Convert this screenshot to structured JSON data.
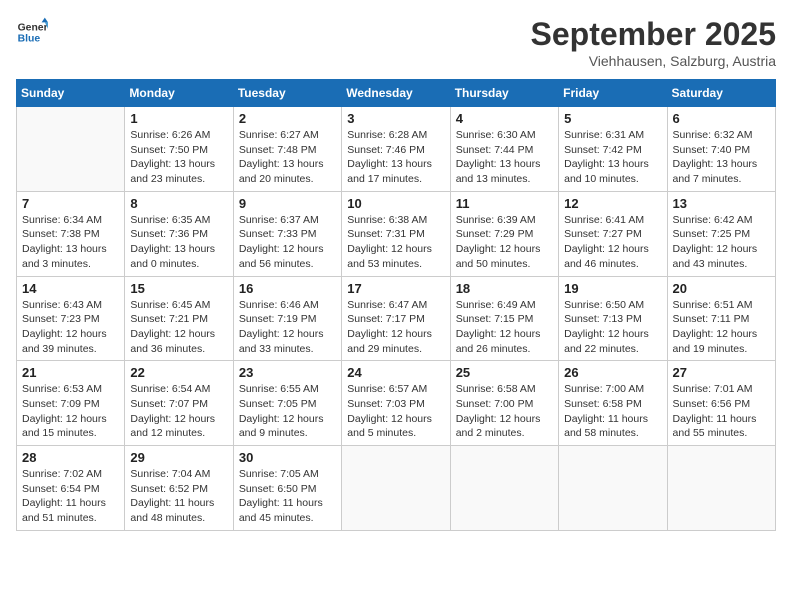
{
  "header": {
    "logo_line1": "General",
    "logo_line2": "Blue",
    "month_title": "September 2025",
    "location": "Viehhausen, Salzburg, Austria"
  },
  "weekdays": [
    "Sunday",
    "Monday",
    "Tuesday",
    "Wednesday",
    "Thursday",
    "Friday",
    "Saturday"
  ],
  "weeks": [
    [
      {
        "day": "",
        "info": ""
      },
      {
        "day": "1",
        "info": "Sunrise: 6:26 AM\nSunset: 7:50 PM\nDaylight: 13 hours\nand 23 minutes."
      },
      {
        "day": "2",
        "info": "Sunrise: 6:27 AM\nSunset: 7:48 PM\nDaylight: 13 hours\nand 20 minutes."
      },
      {
        "day": "3",
        "info": "Sunrise: 6:28 AM\nSunset: 7:46 PM\nDaylight: 13 hours\nand 17 minutes."
      },
      {
        "day": "4",
        "info": "Sunrise: 6:30 AM\nSunset: 7:44 PM\nDaylight: 13 hours\nand 13 minutes."
      },
      {
        "day": "5",
        "info": "Sunrise: 6:31 AM\nSunset: 7:42 PM\nDaylight: 13 hours\nand 10 minutes."
      },
      {
        "day": "6",
        "info": "Sunrise: 6:32 AM\nSunset: 7:40 PM\nDaylight: 13 hours\nand 7 minutes."
      }
    ],
    [
      {
        "day": "7",
        "info": "Sunrise: 6:34 AM\nSunset: 7:38 PM\nDaylight: 13 hours\nand 3 minutes."
      },
      {
        "day": "8",
        "info": "Sunrise: 6:35 AM\nSunset: 7:36 PM\nDaylight: 13 hours\nand 0 minutes."
      },
      {
        "day": "9",
        "info": "Sunrise: 6:37 AM\nSunset: 7:33 PM\nDaylight: 12 hours\nand 56 minutes."
      },
      {
        "day": "10",
        "info": "Sunrise: 6:38 AM\nSunset: 7:31 PM\nDaylight: 12 hours\nand 53 minutes."
      },
      {
        "day": "11",
        "info": "Sunrise: 6:39 AM\nSunset: 7:29 PM\nDaylight: 12 hours\nand 50 minutes."
      },
      {
        "day": "12",
        "info": "Sunrise: 6:41 AM\nSunset: 7:27 PM\nDaylight: 12 hours\nand 46 minutes."
      },
      {
        "day": "13",
        "info": "Sunrise: 6:42 AM\nSunset: 7:25 PM\nDaylight: 12 hours\nand 43 minutes."
      }
    ],
    [
      {
        "day": "14",
        "info": "Sunrise: 6:43 AM\nSunset: 7:23 PM\nDaylight: 12 hours\nand 39 minutes."
      },
      {
        "day": "15",
        "info": "Sunrise: 6:45 AM\nSunset: 7:21 PM\nDaylight: 12 hours\nand 36 minutes."
      },
      {
        "day": "16",
        "info": "Sunrise: 6:46 AM\nSunset: 7:19 PM\nDaylight: 12 hours\nand 33 minutes."
      },
      {
        "day": "17",
        "info": "Sunrise: 6:47 AM\nSunset: 7:17 PM\nDaylight: 12 hours\nand 29 minutes."
      },
      {
        "day": "18",
        "info": "Sunrise: 6:49 AM\nSunset: 7:15 PM\nDaylight: 12 hours\nand 26 minutes."
      },
      {
        "day": "19",
        "info": "Sunrise: 6:50 AM\nSunset: 7:13 PM\nDaylight: 12 hours\nand 22 minutes."
      },
      {
        "day": "20",
        "info": "Sunrise: 6:51 AM\nSunset: 7:11 PM\nDaylight: 12 hours\nand 19 minutes."
      }
    ],
    [
      {
        "day": "21",
        "info": "Sunrise: 6:53 AM\nSunset: 7:09 PM\nDaylight: 12 hours\nand 15 minutes."
      },
      {
        "day": "22",
        "info": "Sunrise: 6:54 AM\nSunset: 7:07 PM\nDaylight: 12 hours\nand 12 minutes."
      },
      {
        "day": "23",
        "info": "Sunrise: 6:55 AM\nSunset: 7:05 PM\nDaylight: 12 hours\nand 9 minutes."
      },
      {
        "day": "24",
        "info": "Sunrise: 6:57 AM\nSunset: 7:03 PM\nDaylight: 12 hours\nand 5 minutes."
      },
      {
        "day": "25",
        "info": "Sunrise: 6:58 AM\nSunset: 7:00 PM\nDaylight: 12 hours\nand 2 minutes."
      },
      {
        "day": "26",
        "info": "Sunrise: 7:00 AM\nSunset: 6:58 PM\nDaylight: 11 hours\nand 58 minutes."
      },
      {
        "day": "27",
        "info": "Sunrise: 7:01 AM\nSunset: 6:56 PM\nDaylight: 11 hours\nand 55 minutes."
      }
    ],
    [
      {
        "day": "28",
        "info": "Sunrise: 7:02 AM\nSunset: 6:54 PM\nDaylight: 11 hours\nand 51 minutes."
      },
      {
        "day": "29",
        "info": "Sunrise: 7:04 AM\nSunset: 6:52 PM\nDaylight: 11 hours\nand 48 minutes."
      },
      {
        "day": "30",
        "info": "Sunrise: 7:05 AM\nSunset: 6:50 PM\nDaylight: 11 hours\nand 45 minutes."
      },
      {
        "day": "",
        "info": ""
      },
      {
        "day": "",
        "info": ""
      },
      {
        "day": "",
        "info": ""
      },
      {
        "day": "",
        "info": ""
      }
    ]
  ]
}
